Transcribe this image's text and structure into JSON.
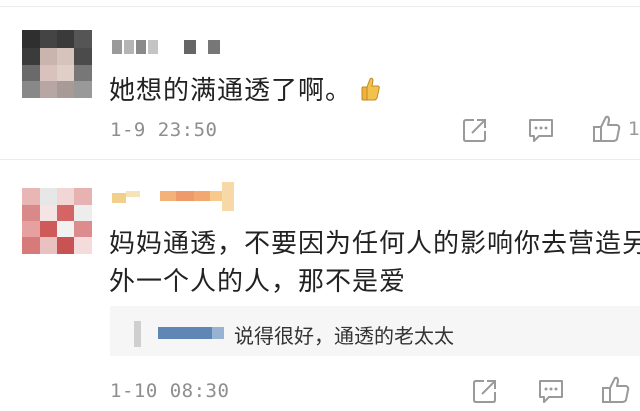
{
  "comments": [
    {
      "text": "她想的满通透了啊。",
      "emoji_icon": "thumbs-up-icon",
      "time": "1-9 23:50",
      "like_count": "1"
    },
    {
      "text_line1": "妈妈通透，不要因为任何人的影响你去营造另",
      "text_line2": "外一个人的人，那不是爱",
      "reply": {
        "text": "说得很好，通透的老太太"
      },
      "time": "1-10 08:30"
    }
  ],
  "icons": {
    "share": "share-icon",
    "comment": "comment-icon",
    "like": "like-icon"
  },
  "colors": {
    "text": "#222222",
    "secondary": "#8e8e8e",
    "icon": "#9a9a9a",
    "reply_bg": "#f6f6f6"
  }
}
